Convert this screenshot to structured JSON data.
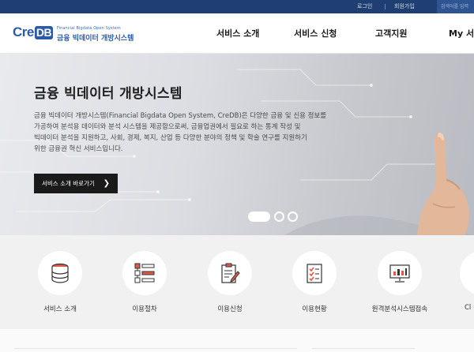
{
  "topbar": {
    "login": "로그인",
    "signup": "회원가입",
    "search_placeholder": "검색어를 입력"
  },
  "logo": {
    "mark_cre": "Cre",
    "mark_db": "DB",
    "sub": "Financial Bigdata Open System",
    "name": "금융 빅데이터 개방시스템"
  },
  "nav": {
    "items": [
      {
        "label": "서비스 소개"
      },
      {
        "label": "서비스 신청"
      },
      {
        "label": "고객지원"
      },
      {
        "label": "My 서비"
      }
    ]
  },
  "hero": {
    "title": "금융 빅데이터 개방시스템",
    "desc_lines": [
      "금융 빅데이터 개방시스템(Financial Bigdata Open System, CreDB)은 다양한 금융 및 신용 정보를",
      "가공하여 분석용 데이터와 분석 시스템을 제공함으로써, 금융업권에서 필요로 하는 통계 작성 및",
      "빅데이터 분석을 지원하고, 사회, 경제, 복지, 산업 등 다양한 분야의 정책 및 학술 연구를 지원하기",
      "위한 금융권 혁신 서비스입니다."
    ],
    "cta_label": "서비스 소개 바로가기",
    "cta_arrow": "❯",
    "slides": {
      "count": 3,
      "active": 1
    }
  },
  "quick_menu": {
    "items": [
      {
        "label": "서비스 소개",
        "icon": "database-icon"
      },
      {
        "label": "이용절차",
        "icon": "flowchart-icon"
      },
      {
        "label": "이용신청",
        "icon": "clipboard-pen-icon"
      },
      {
        "label": "이용현황",
        "icon": "checklist-icon"
      },
      {
        "label": "원격분석시스템접속",
        "icon": "monitor-chart-icon"
      },
      {
        "label": "Cl",
        "icon": "partial-icon"
      }
    ]
  },
  "colors": {
    "topbar": "#1f3f73",
    "brand": "#2c5aa8",
    "accent_red": "#e05a4a",
    "cta": "#1a1a1a"
  }
}
